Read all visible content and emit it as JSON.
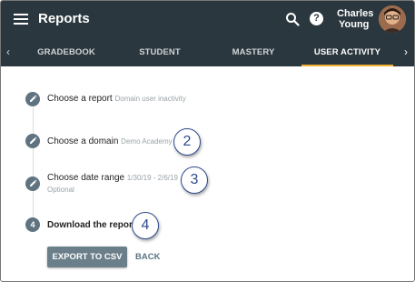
{
  "header": {
    "title": "Reports",
    "menu_icon": "menu-icon",
    "search_icon": "search-icon",
    "help_icon": "help-icon",
    "help_glyph": "?",
    "user_first_name": "Charles",
    "user_last_name": "Young"
  },
  "tabs": {
    "prev_arrow": "‹",
    "next_arrow": "›",
    "items": [
      {
        "label": "GRADEBOOK",
        "active": false
      },
      {
        "label": "STUDENT",
        "active": false
      },
      {
        "label": "MASTERY",
        "active": false
      },
      {
        "label": "USER ACTIVITY",
        "active": true
      }
    ],
    "active_color": "#f2b134"
  },
  "steps": [
    {
      "marker": "edit-icon",
      "title": "Choose a report",
      "value": "Domain user inactivity",
      "optional": ""
    },
    {
      "marker": "edit-icon",
      "title": "Choose a domain",
      "value": "Demo Academy",
      "optional": ""
    },
    {
      "marker": "edit-icon",
      "title": "Choose date range",
      "value": "1/30/19 - 2/6/19",
      "optional": "Optional"
    },
    {
      "marker": "4",
      "title": "Download the report",
      "value": "",
      "optional": ""
    }
  ],
  "callouts": [
    "2",
    "3",
    "4"
  ],
  "actions": {
    "export_label": "EXPORT TO CSV",
    "back_label": "BACK"
  },
  "colors": {
    "header_bg": "#2b373e",
    "step_circle": "#5f7480",
    "callout_border": "#2e4a8c",
    "button_bg": "#6b7f8a"
  }
}
